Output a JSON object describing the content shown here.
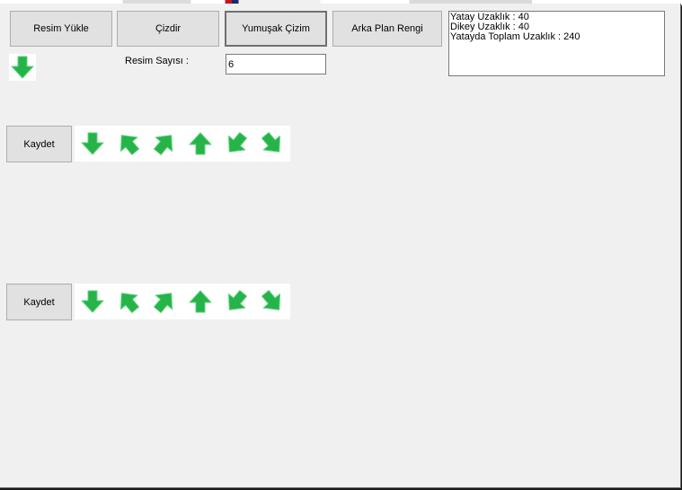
{
  "toolbar": {
    "load_label": "Resim Yükle",
    "draw_label": "Çizdir",
    "smooth_label": "Yumuşak Çizim",
    "background_label": "Arka Plan Rengi"
  },
  "image_count": {
    "label": "Resim Sayısı :",
    "value": "6"
  },
  "info": {
    "line1": "Yatay Uzaklık : 40",
    "line2": "Dikey Uzaklık : 40",
    "line3": "Yatayda Toplam Uzaklık : 240"
  },
  "rows": [
    {
      "save_label": "Kaydet",
      "arrows": [
        "down",
        "up-left",
        "up-right",
        "up",
        "down-left",
        "down-right"
      ]
    },
    {
      "save_label": "Kaydet",
      "arrows": [
        "down",
        "up-left",
        "up-right",
        "up",
        "down-left",
        "down-right"
      ]
    }
  ],
  "loaded_image": {
    "icon": "down-arrow-icon"
  },
  "colors": {
    "arrow_green": "#25b34a",
    "arrow_outline": "#5fd47a",
    "window_bg": "#f0f0f0",
    "button_bg": "#e1e1e1"
  }
}
